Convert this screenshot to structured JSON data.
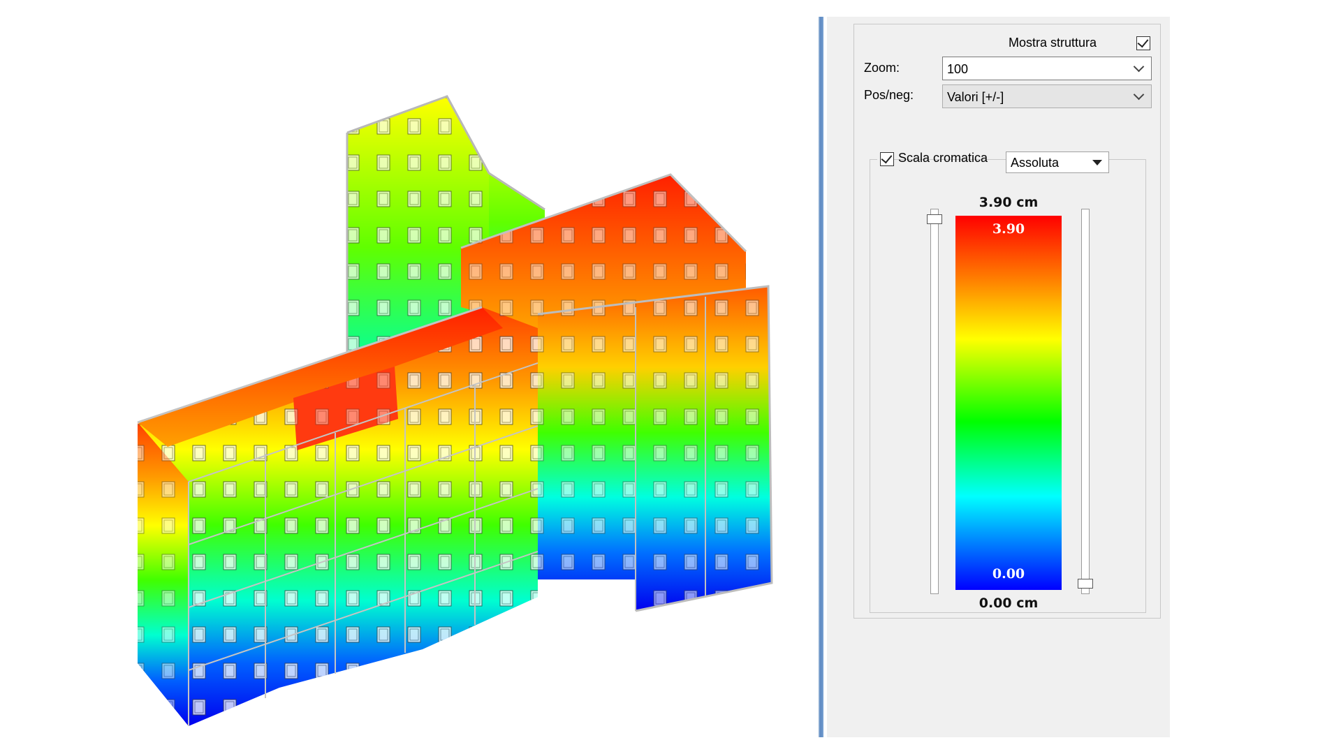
{
  "viewport": {
    "name": "3D deformed structure view",
    "colors": [
      "#ff0000",
      "#ff8000",
      "#ffff00",
      "#00ff00",
      "#00ffff",
      "#0000ff"
    ]
  },
  "panel": {
    "mostra_struttura": {
      "label": "Mostra struttura",
      "checked": true
    },
    "zoom": {
      "label": "Zoom:",
      "value": "100"
    },
    "posneg": {
      "label": "Pos/neg:",
      "value": "Valori  [+/-]"
    },
    "scala": {
      "checkbox_label": "Scala cromatica",
      "checked": true,
      "mode": "Assoluta",
      "max_label": "3.90 cm",
      "min_label": "0.00 cm",
      "bar_max": "3.90",
      "bar_min": "0.00"
    }
  }
}
